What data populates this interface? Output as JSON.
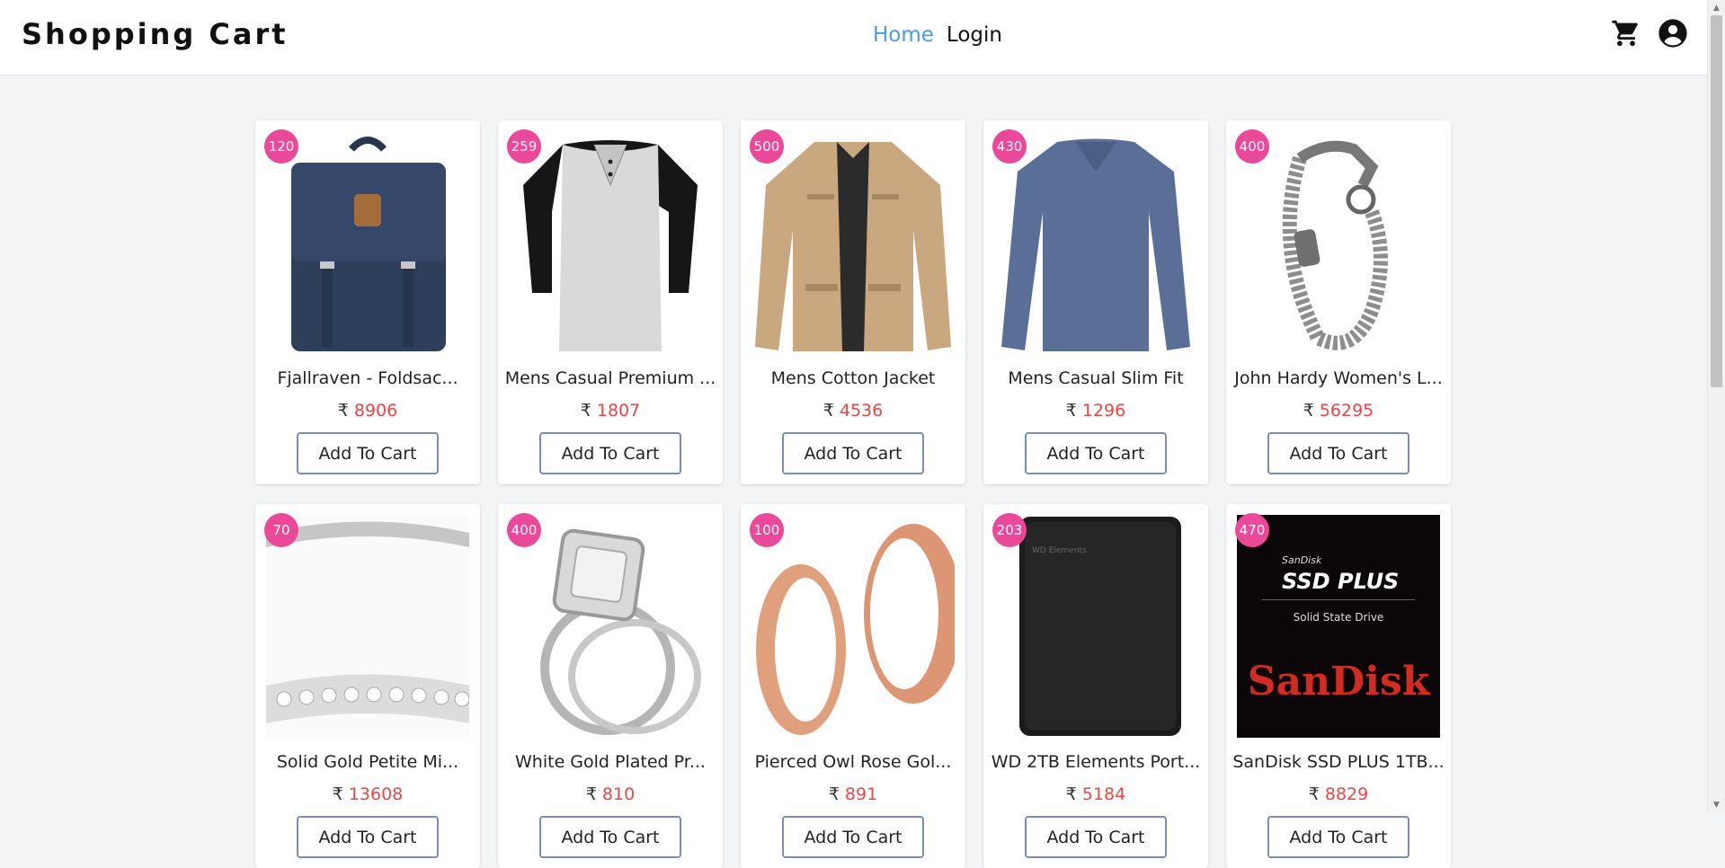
{
  "header": {
    "brand": "Shopping Cart",
    "nav": {
      "home": "Home",
      "login": "Login"
    },
    "icons": [
      "cart-icon",
      "account-icon"
    ]
  },
  "currency": "₹",
  "add_label": "Add To Cart",
  "products": [
    {
      "badge": "120",
      "title": "Fjallraven - Foldsac...",
      "price": "8906",
      "image": "backpack"
    },
    {
      "badge": "259",
      "title": "Mens Casual Premium ...",
      "price": "1807",
      "image": "raglan-tshirt"
    },
    {
      "badge": "500",
      "title": "Mens Cotton Jacket",
      "price": "4536",
      "image": "cotton-jacket"
    },
    {
      "badge": "430",
      "title": "Mens Casual Slim Fit",
      "price": "1296",
      "image": "slim-fit-shirt"
    },
    {
      "badge": "400",
      "title": "John Hardy Women's L...",
      "price": "56295",
      "image": "chain-bracelet"
    },
    {
      "badge": "70",
      "title": "Solid Gold Petite Mi...",
      "price": "13608",
      "image": "gold-ring"
    },
    {
      "badge": "400",
      "title": "White Gold Plated Pr...",
      "price": "810",
      "image": "diamond-ring"
    },
    {
      "badge": "100",
      "title": "Pierced Owl Rose Gol...",
      "price": "891",
      "image": "rose-gold-plugs"
    },
    {
      "badge": "203",
      "title": "WD 2TB Elements Port...",
      "price": "5184",
      "image": "wd-hard-drive"
    },
    {
      "badge": "470",
      "title": "SanDisk SSD PLUS 1TB...",
      "price": "8829",
      "image": "sandisk-ssd"
    }
  ],
  "image_text": {
    "wd_brand": "WD Elements",
    "sandisk_small": "SanDisk",
    "sandisk_ssd": "SSD PLUS",
    "sandisk_sub": "Solid State Drive",
    "sandisk_logo": "SanDisk"
  },
  "colors": {
    "accent": "#4a9be0",
    "badge": "#ec4899",
    "price": "#ef4444"
  }
}
